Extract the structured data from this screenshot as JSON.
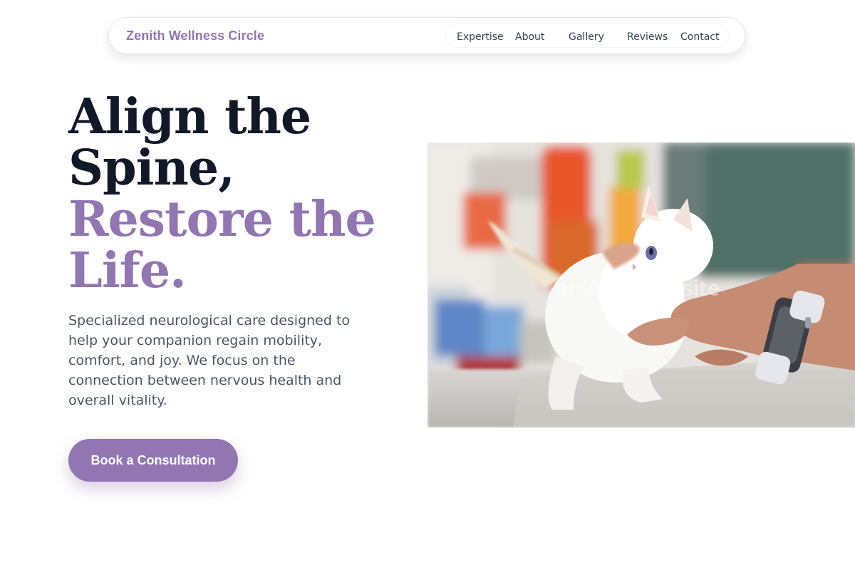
{
  "nav": {
    "brand": "Zenith Wellness Circle",
    "links": [
      "Expertise",
      "About",
      "Gallery",
      "Reviews",
      "Contact"
    ]
  },
  "hero": {
    "heading_lines": [
      "Align the",
      "Spine,"
    ],
    "heading_accent_lines": [
      "Restore the",
      "Life."
    ],
    "description": "Specialized neurological care designed to help your companion regain mobility, comfort, and joy. We focus on the connection between nervous health and overall vitality.",
    "cta_label": "Book a Consultation"
  },
  "photo": {
    "watermark": "animalchiro.site"
  },
  "colors": {
    "accent": "#9176b2",
    "heading": "#111827",
    "body_text": "#4b5563",
    "background": "#ffffff"
  }
}
